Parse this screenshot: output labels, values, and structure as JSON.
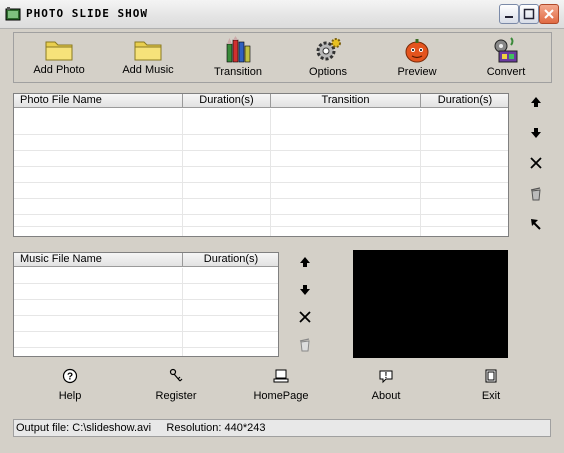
{
  "window": {
    "title": "PHOTO SLIDE SHOW"
  },
  "toolbar": {
    "add_photo": "Add Photo",
    "add_music": "Add Music",
    "transition": "Transition",
    "options": "Options",
    "preview": "Preview",
    "convert": "Convert"
  },
  "photo_table": {
    "headers": [
      "Photo File Name",
      "Duration(s)",
      "Transition",
      "Duration(s)"
    ]
  },
  "music_table": {
    "headers": [
      "Music File Name",
      "Duration(s)"
    ]
  },
  "bottom": {
    "help": "Help",
    "register": "Register",
    "homepage": "HomePage",
    "about": "About",
    "exit": "Exit"
  },
  "status": {
    "text": "Output file: C:\\slideshow.avi     Resolution: 440*243"
  },
  "colors": {
    "preview_bg": "#000000",
    "window_bg": "#d4d0c8"
  }
}
